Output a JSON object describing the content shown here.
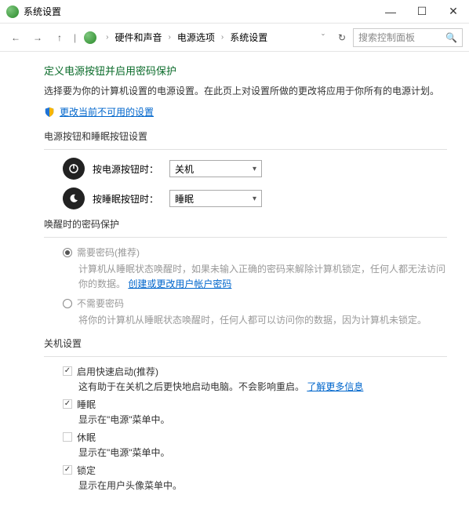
{
  "window": {
    "title": "系统设置",
    "minimize": "—",
    "maximize": "☐",
    "close": "✕"
  },
  "nav": {
    "back": "←",
    "forward": "→",
    "up": "↑",
    "crumbs": [
      "硬件和声音",
      "电源选项",
      "系统设置"
    ],
    "dropdown_caret": "ˇ",
    "refresh": "↻",
    "search_placeholder": "搜索控制面板"
  },
  "main": {
    "heading": "定义电源按钮并启用密码保护",
    "description": "选择要为你的计算机设置的电源设置。在此页上对设置所做的更改将应用于你所有的电源计划。",
    "change_link": "更改当前不可用的设置"
  },
  "buttons_section": {
    "title": "电源按钮和睡眠按钮设置",
    "power_label": "按电源按钮时：",
    "power_value": "关机",
    "sleep_label": "按睡眠按钮时：",
    "sleep_value": "睡眠"
  },
  "password_section": {
    "title": "唤醒时的密码保护",
    "require_label": "需要密码(推荐)",
    "require_desc_a": "计算机从睡眠状态唤醒时，如果未输入正确的密码来解除计算机锁定，任何人都无法访问你的数据。",
    "account_link": "创建或更改用户帐户密码",
    "norequire_label": "不需要密码",
    "norequire_desc": "将你的计算机从睡眠状态唤醒时，任何人都可以访问你的数据，因为计算机未锁定。"
  },
  "shutdown_section": {
    "title": "关机设置",
    "fastboot_label": "启用快速启动(推荐)",
    "fastboot_desc": "这有助于在关机之后更快地启动电脑。不会影响重启。",
    "fastboot_link": "了解更多信息",
    "sleep_label": "睡眠",
    "sleep_desc": "显示在\"电源\"菜单中。",
    "hibernate_label": "休眠",
    "hibernate_desc": "显示在\"电源\"菜单中。",
    "lock_label": "锁定",
    "lock_desc": "显示在用户头像菜单中。"
  }
}
